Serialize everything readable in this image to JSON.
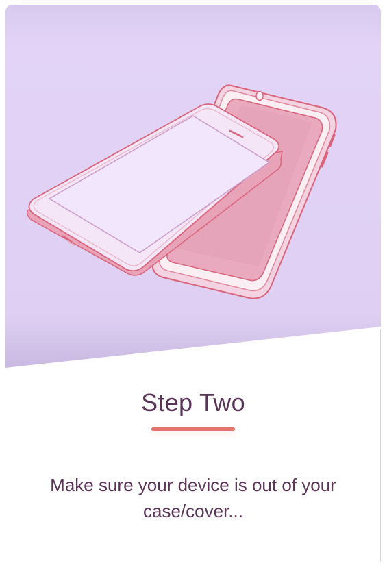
{
  "step": {
    "title": "Step Two",
    "description": "Make sure your device is out of your case/cover..."
  },
  "illustration": {
    "icon": "phone-removed-from-case-illustration"
  },
  "colors": {
    "hero_background": "#e3d4f7",
    "title_text": "#5a3457",
    "accent_divider": "#e3746c",
    "case_fill": "#e8a7bd",
    "case_stroke": "#d9637a",
    "phone_fill": "#f4e6f6"
  }
}
